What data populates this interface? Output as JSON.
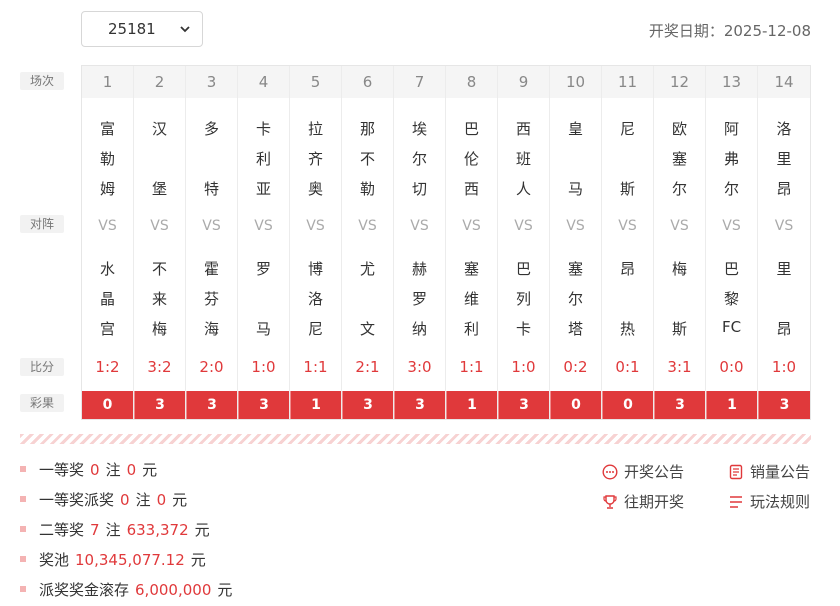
{
  "issue_select": {
    "value": "25181"
  },
  "draw_date": "开奖日期：2025-12-08",
  "row_labels": {
    "match_no": "场次",
    "matchup": "对阵",
    "score": "比分",
    "result": "彩果"
  },
  "vs_label": "VS",
  "matches": [
    {
      "no": "1",
      "home": [
        "富",
        "勒",
        "姆"
      ],
      "away": [
        "水",
        "晶",
        "宫"
      ],
      "score": "1:2",
      "result": "0"
    },
    {
      "no": "2",
      "home": [
        "汉",
        "",
        "堡"
      ],
      "away": [
        "不",
        "来",
        "梅"
      ],
      "score": "3:2",
      "result": "3"
    },
    {
      "no": "3",
      "home": [
        "多",
        "",
        "特"
      ],
      "away": [
        "霍",
        "芬",
        "海"
      ],
      "score": "2:0",
      "result": "3"
    },
    {
      "no": "4",
      "home": [
        "卡",
        "利",
        "亚"
      ],
      "away": [
        "罗",
        "",
        "马"
      ],
      "score": "1:0",
      "result": "3"
    },
    {
      "no": "5",
      "home": [
        "拉",
        "齐",
        "奥"
      ],
      "away": [
        "博",
        "洛",
        "尼"
      ],
      "score": "1:1",
      "result": "1"
    },
    {
      "no": "6",
      "home": [
        "那",
        "不",
        "勒"
      ],
      "away": [
        "尤",
        "",
        "文"
      ],
      "score": "2:1",
      "result": "3"
    },
    {
      "no": "7",
      "home": [
        "埃",
        "尔",
        "切"
      ],
      "away": [
        "赫",
        "罗",
        "纳"
      ],
      "score": "3:0",
      "result": "3"
    },
    {
      "no": "8",
      "home": [
        "巴",
        "伦",
        "西"
      ],
      "away": [
        "塞",
        "维",
        "利"
      ],
      "score": "1:1",
      "result": "1"
    },
    {
      "no": "9",
      "home": [
        "西",
        "班",
        "人"
      ],
      "away": [
        "巴",
        "列",
        "卡"
      ],
      "score": "1:0",
      "result": "3"
    },
    {
      "no": "10",
      "home": [
        "皇",
        "",
        "马"
      ],
      "away": [
        "塞",
        "尔",
        "塔"
      ],
      "score": "0:2",
      "result": "0"
    },
    {
      "no": "11",
      "home": [
        "尼",
        "",
        "斯"
      ],
      "away": [
        "昂",
        "",
        "热"
      ],
      "score": "0:1",
      "result": "0"
    },
    {
      "no": "12",
      "home": [
        "欧",
        "塞",
        "尔"
      ],
      "away": [
        "梅",
        "",
        "斯"
      ],
      "score": "3:1",
      "result": "3"
    },
    {
      "no": "13",
      "home": [
        "阿",
        "弗",
        "尔"
      ],
      "away": [
        "巴",
        "黎",
        "FC"
      ],
      "score": "0:0",
      "result": "1"
    },
    {
      "no": "14",
      "home": [
        "洛",
        "里",
        "昂"
      ],
      "away": [
        "里",
        "",
        "昂"
      ],
      "score": "1:0",
      "result": "3"
    }
  ],
  "prizes": [
    {
      "label": "一等奖",
      "count": "0",
      "unit_mid": "注",
      "amount": "0",
      "unit": "元"
    },
    {
      "label": "一等奖派奖",
      "count": "0",
      "unit_mid": "注",
      "amount": "0",
      "unit": "元"
    },
    {
      "label": "二等奖",
      "count": "7",
      "unit_mid": "注",
      "amount": "633,372",
      "unit": "元"
    }
  ],
  "pool": {
    "label": "奖池",
    "amount": "10,345,077.12",
    "unit": "元"
  },
  "rollover": {
    "label": "派奖奖金滚存",
    "amount": "6,000,000",
    "unit": "元"
  },
  "links": {
    "draw_notice": "开奖公告",
    "past_draws": "往期开奖",
    "sales_notice": "销量公告",
    "rules": "玩法规则"
  },
  "colors": {
    "accent": "#e0393b",
    "label_bg": "#f2f2f2"
  }
}
